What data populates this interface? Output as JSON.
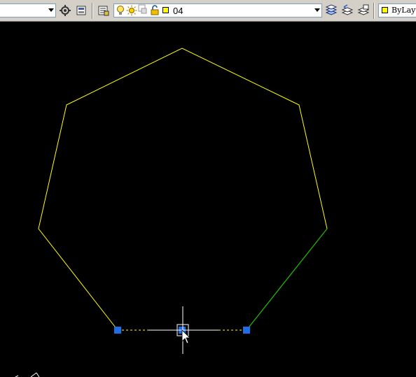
{
  "toolbar": {
    "layer_name": "04",
    "color_value": "ByLayer"
  },
  "colors": {
    "background": "#000000",
    "polygon_edge": "#ffff00",
    "selected_edge": "#00c000",
    "grip": "#1e6ee8",
    "crosshair": "#ffffff",
    "layer_swatch": "#ffff00"
  },
  "drawing": {
    "shape": "heptagon",
    "sides": 7,
    "grips": 3
  }
}
